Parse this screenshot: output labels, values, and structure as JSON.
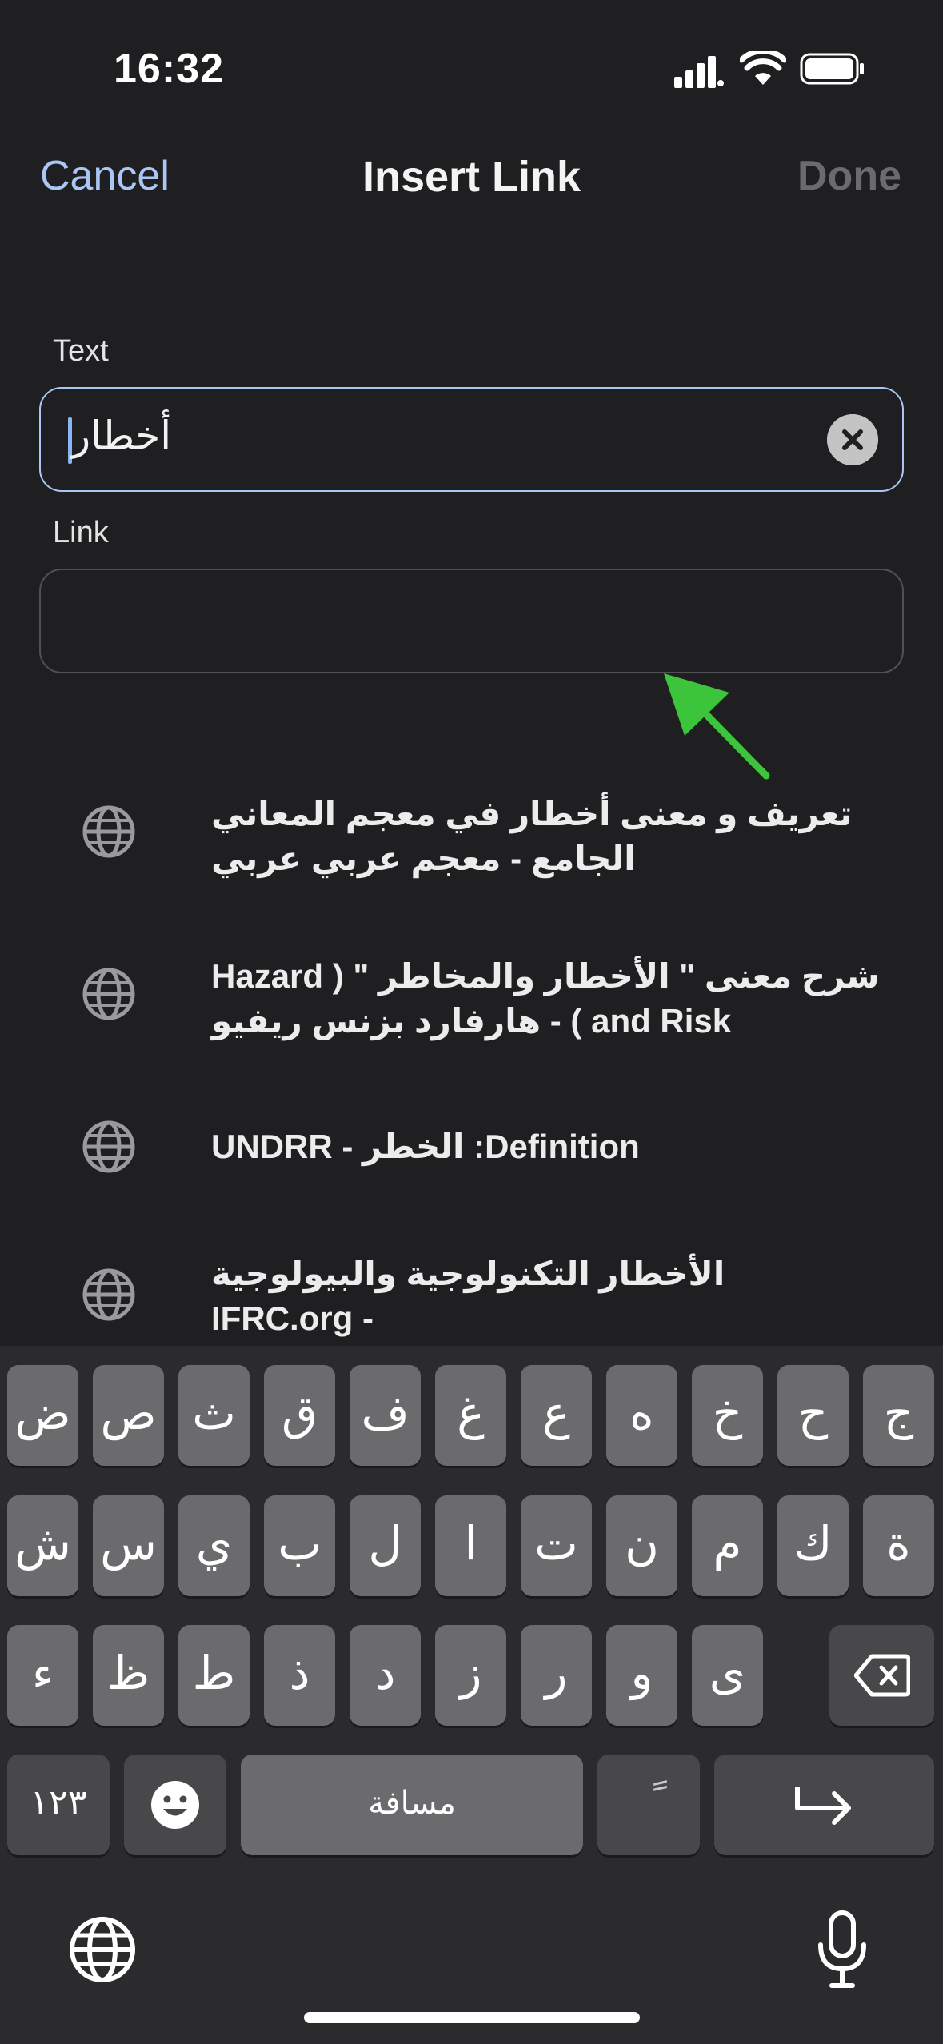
{
  "status": {
    "time": "16:32"
  },
  "nav": {
    "cancel": "Cancel",
    "title": "Insert Link",
    "done": "Done"
  },
  "fields": {
    "text_label": "Text",
    "text_value": "أخطار",
    "link_label": "Link",
    "link_value": ""
  },
  "suggestions": [
    {
      "line1": "تعريف و معنى أخطار في معجم المعاني",
      "line2": "الجامع - معجم عربي عربي"
    },
    {
      "line1": "شرح معنى \" الأخطار والمخاطر \" ( Hazard",
      "line2": "and Risk ) - هارفارد بزنس ريفيو"
    },
    {
      "line1": "Definition: الخطر - UNDRR",
      "line2": ""
    },
    {
      "line1": "الأخطار التكنولوجية والبيولوجية",
      "line2": "- IFRC.org"
    }
  ],
  "keyboard": {
    "row1": [
      "ض",
      "ص",
      "ث",
      "ق",
      "ف",
      "غ",
      "ع",
      "ه",
      "خ",
      "ح",
      "ج"
    ],
    "row2": [
      "ش",
      "س",
      "ي",
      "ب",
      "ل",
      "ا",
      "ت",
      "ن",
      "م",
      "ك",
      "ة"
    ],
    "row3": [
      "ء",
      "ظ",
      "ط",
      "ذ",
      "د",
      "ز",
      "ر",
      "و",
      "ى"
    ],
    "numbers_key": "١٢٣",
    "space_key": "مسافة",
    "diacritic_key": "ً"
  },
  "colors": {
    "accent": "#a9c6f4",
    "background": "#1f1f21",
    "arrow": "#3cc43a"
  }
}
